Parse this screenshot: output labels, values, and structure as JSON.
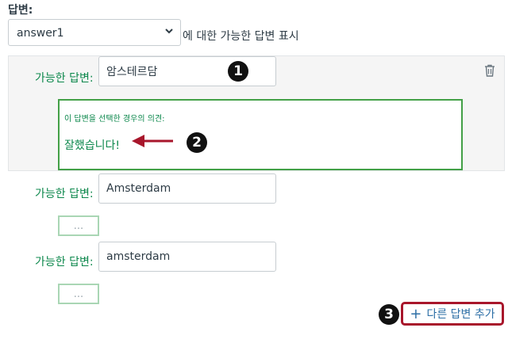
{
  "answers_heading": "답변:",
  "answer_select": {
    "selected": "answer1",
    "suffix": "에 대한 가능한 답변 표시"
  },
  "possible_answers": [
    {
      "label": "가능한 답변:",
      "value": "암스테르담"
    },
    {
      "label": "가능한 답변:",
      "value": "Amsterdam"
    },
    {
      "label": "가능한 답변:",
      "value": "amsterdam"
    }
  ],
  "comment": {
    "title": "이 답변을 선택한 경우의 의견:",
    "text": "잘했습니다!"
  },
  "more_button_label": "...",
  "add_button_label": "다른 답변 추가",
  "badges": [
    "1",
    "2",
    "3"
  ],
  "colors": {
    "green": "#0b874b",
    "highlight_border": "#a8162b",
    "arrow": "#a8162b"
  }
}
